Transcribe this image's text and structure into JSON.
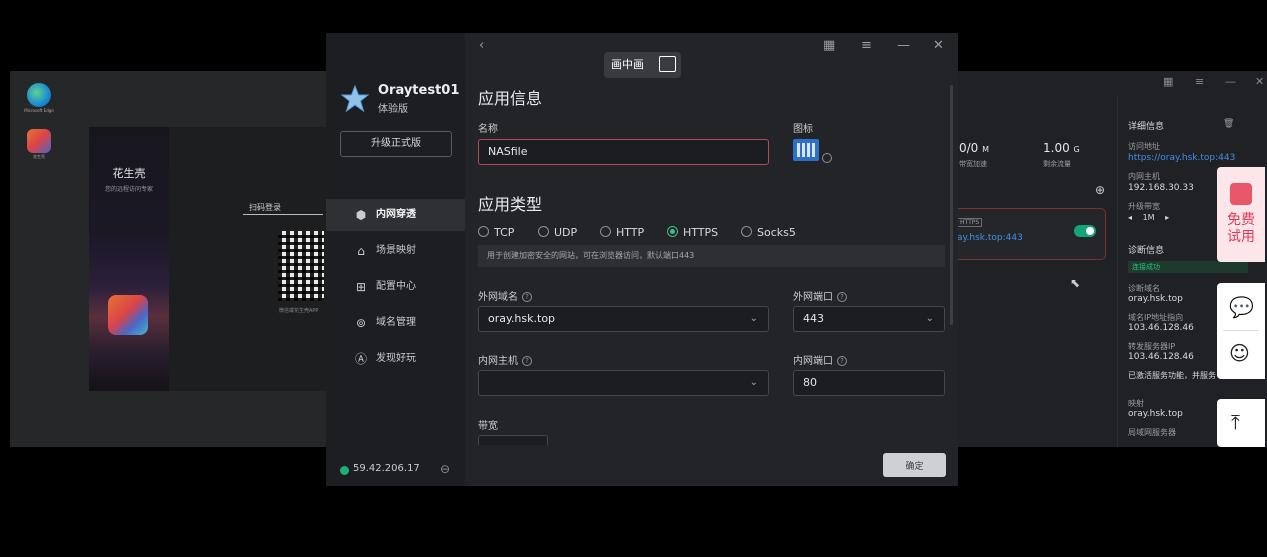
{
  "desktop": {
    "icons": [
      {
        "label": "Microsoft Edge",
        "icon": "edge-icon"
      },
      {
        "label": "花生壳",
        "icon": "huashengke-icon"
      }
    ]
  },
  "login_window": {
    "brand": "花生壳",
    "brand_sub": "您的远程访问专家",
    "scan_tab": "扫码登录",
    "qr_hint": "微信或花生壳APP"
  },
  "background_panel": {
    "stat1_value": "0/0",
    "stat1_unit": "M",
    "stat1_label": "带宽加速",
    "stat2_value": "1.00",
    "stat2_unit": "G",
    "stat2_label": "剩余流量",
    "card_tag": "HTTPS",
    "card_url": "ay.hsk.top:443",
    "detail_title": "详细信息",
    "access_label": "访问地址",
    "access_url": "https://oray.hsk.top:443",
    "lan_host_label": "内网主机",
    "lan_host": "192.168.30.33",
    "bandwidth_label": "升级带宽",
    "bandwidth_value": "1M",
    "diag_title": "诊断信息",
    "diag_status": "连接成功",
    "diag_domain_label": "诊断域名",
    "diag_domain": "oray.hsk.top",
    "resolve_label": "域名IP地址指向",
    "resolve_ip": "103.46.128.46",
    "forward_label": "转发服务器IP",
    "forward_ip": "103.46.128.46",
    "activated_note": "已激活服务功能，并服务",
    "map_label": "映射",
    "map_value": "oray.hsk.top",
    "lan_service_label": "局域网服务器"
  },
  "float_ad": {
    "trial_line1": "免费",
    "trial_line2": "试用"
  },
  "app": {
    "name": "Oraytest01",
    "version": "体验版",
    "upgrade_label": "升级正式版",
    "nav": [
      {
        "label": "内网穿透",
        "icon": "cube-icon",
        "active": true
      },
      {
        "label": "场景映射",
        "icon": "scene-icon"
      },
      {
        "label": "配置中心",
        "icon": "grid-icon"
      },
      {
        "label": "域名管理",
        "icon": "domain-icon"
      },
      {
        "label": "发现好玩",
        "icon": "discover-icon"
      }
    ],
    "ip": "59.42.206.17",
    "pip_label": "画中画"
  },
  "form": {
    "section_app_info": "应用信息",
    "name_label": "名称",
    "name_value": "NASfile",
    "icon_label": "图标",
    "section_app_type": "应用类型",
    "types": [
      "TCP",
      "UDP",
      "HTTP",
      "HTTPS",
      "Socks5"
    ],
    "selected_type": "HTTPS",
    "type_hint": "用于创建加密安全的网站，可在浏览器访问，默认端口443",
    "ext_domain_label": "外网域名",
    "ext_domain_value": "oray.hsk.top",
    "ext_port_label": "外网端口",
    "ext_port_value": "443",
    "lan_host_label": "内网主机",
    "lan_host_value": "",
    "lan_port_label": "内网端口",
    "lan_port_value": "80",
    "bandwidth_label": "带宽",
    "confirm_label": "确定"
  },
  "colors": {
    "accent_green": "#3fbf8c",
    "error_border": "#b54b52",
    "link_blue": "#3f8fe8"
  }
}
